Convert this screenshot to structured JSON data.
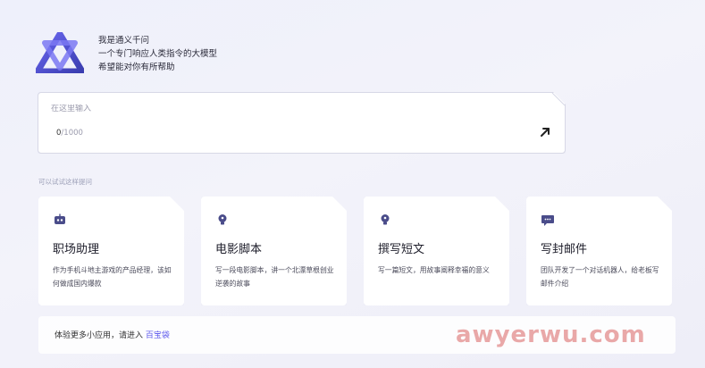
{
  "intro": {
    "line1": "我是通义千问",
    "line2": "一个专门响应人类指令的大模型",
    "line3": "希望能对你有所帮助"
  },
  "input": {
    "placeholder": "在这里输入",
    "count_current": "0",
    "count_max": "/1000"
  },
  "suggestions_label": "可以试试这样提问",
  "cards": [
    {
      "title": "职场助理",
      "desc": "作为手机斗地主游戏的产品经理，该如何做成国内爆款",
      "icon": "robot-icon"
    },
    {
      "title": "电影脚本",
      "desc": "写一段电影脚本，讲一个北漂草根创业逆袭的故事",
      "icon": "lightbulb-icon"
    },
    {
      "title": "撰写短文",
      "desc": "写一篇短文，用故事阐释幸福的意义",
      "icon": "lightbulb-icon"
    },
    {
      "title": "写封邮件",
      "desc": "团队开发了一个对话机器人，给老板写邮件介绍",
      "icon": "chat-icon"
    }
  ],
  "footer": {
    "text": "体验更多小应用，请进入",
    "link": "百宝袋"
  },
  "watermark": "awyerwu.com",
  "colors": {
    "accent": "#615ced",
    "icon": "#4a4c8a"
  }
}
